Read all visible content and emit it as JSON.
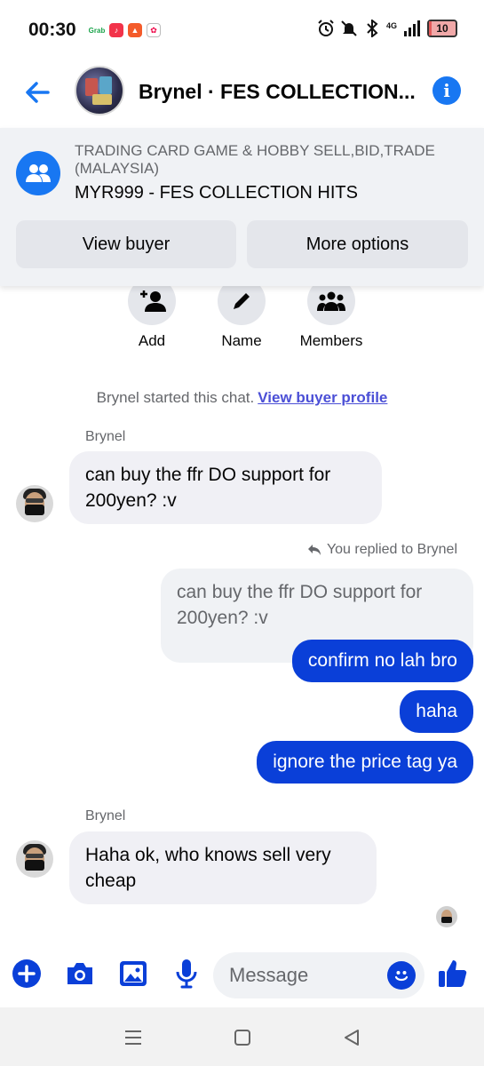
{
  "status_bar": {
    "time": "00:30",
    "apps": [
      "Grab",
      "Music",
      "Game",
      "Gallery"
    ],
    "network": "4G",
    "battery": "10",
    "battery_level": 0.1
  },
  "header": {
    "title": "Brynel · FES COLLECTION...",
    "icons": [
      "back-arrow-icon",
      "group-avatar",
      "info-icon"
    ]
  },
  "banner": {
    "group_name": "TRADING CARD GAME & HOBBY SELL,BID,TRADE (MALAYSIA)",
    "item": "MYR999 - FES COLLECTION HITS",
    "view_buyer": "View buyer",
    "more_options": "More options"
  },
  "group_actions": {
    "add": "Add",
    "name": "Name",
    "members": "Members"
  },
  "system_message": {
    "text": "Brynel started this chat.",
    "link": "View buyer profile"
  },
  "messages": {
    "sender1": "Brynel",
    "msg1": "can buy the ffr DO support for 200yen? :v",
    "reply_note": "You replied to Brynel",
    "quoted": "can buy the ffr DO support for 200yen? :v",
    "out1": "confirm no lah bro",
    "out2": "haha",
    "out3": "ignore the price tag ya",
    "sender2": "Brynel",
    "msg2": "Haha ok, who knows sell very cheap"
  },
  "composer": {
    "placeholder": "Message"
  },
  "colors": {
    "accent": "#1877f2",
    "outgoing_bubble": "#0a3fd8",
    "incoming_bubble": "#f0f0f5",
    "link": "#4b4fd6"
  }
}
